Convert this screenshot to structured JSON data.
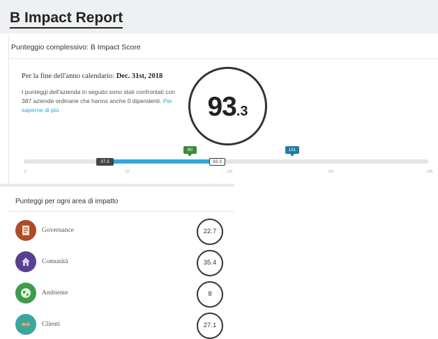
{
  "header": {
    "title": "B Impact Report"
  },
  "overall": {
    "title": "Punteggio complessivo: B Impact Score",
    "period_prefix": "Per la fine dell'anno calendario:",
    "period_date": "Dec. 31st, 2018",
    "description": "I punteggi dell'azienda in seguito sono stati confrontati con 387 aziende ordinarie che hanno anche 0 dipendenti.",
    "learn_more": "Per saperne di più",
    "score_main": "93",
    "score_dec": ".3"
  },
  "benchmark": {
    "low_marker": "37.5",
    "company_marker": "93.3",
    "green_marker": "80",
    "blue_marker": "131",
    "ticks": [
      "0",
      "50",
      "100",
      "150",
      "200"
    ]
  },
  "areas": {
    "title": "Punteggi per ogni area di impatto",
    "items": [
      {
        "label": "Governance",
        "score": "22.7",
        "icon": "document-icon",
        "color": "#b04a2a"
      },
      {
        "label": "Comunità",
        "score": "35.4",
        "icon": "community-icon",
        "color": "#5a3f8f"
      },
      {
        "label": "Ambiente",
        "score": "8",
        "icon": "globe-icon",
        "color": "#3f9b4b"
      },
      {
        "label": "Clienti",
        "score": "27.1",
        "icon": "handshake-icon",
        "color": "#3aa6a0"
      }
    ]
  }
}
